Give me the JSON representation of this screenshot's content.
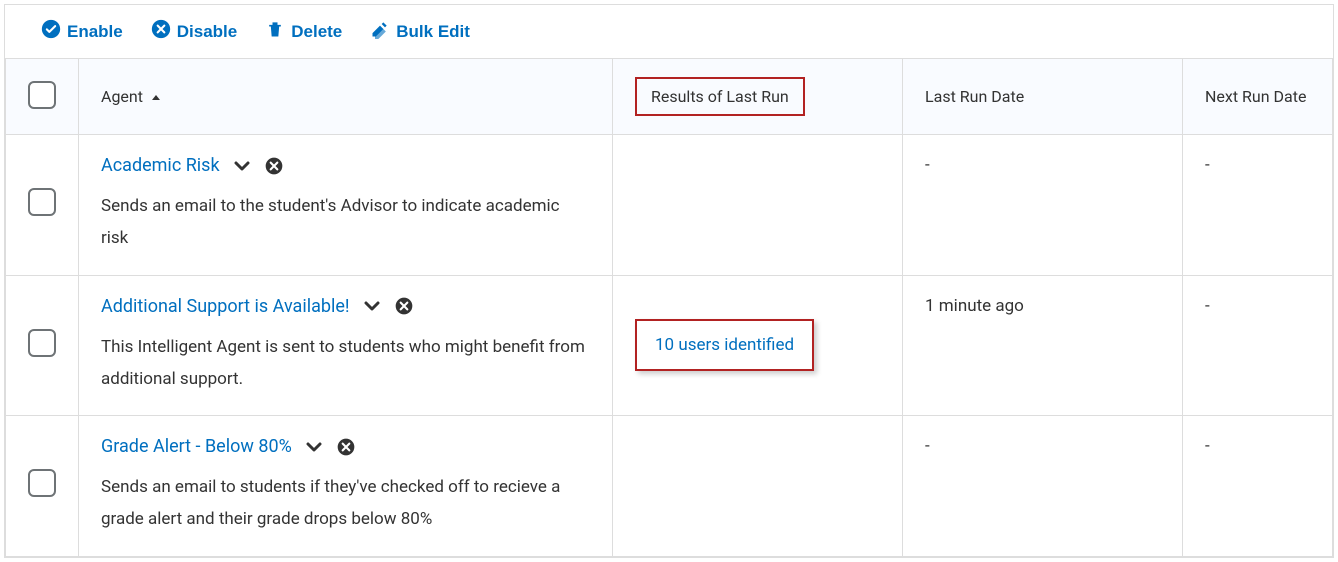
{
  "toolbar": {
    "enable": "Enable",
    "disable": "Disable",
    "delete": "Delete",
    "bulkedit": "Bulk Edit"
  },
  "headers": {
    "agent": "Agent",
    "results": "Results of Last Run",
    "lastrun": "Last Run Date",
    "nextrun": "Next Run Date"
  },
  "rows": [
    {
      "title": "Academic Risk",
      "desc": "Sends an email to the student's Advisor to indicate academic risk",
      "results": "",
      "lastrun": "-",
      "nextrun": "-"
    },
    {
      "title": "Additional Support is Available!",
      "desc": "This Intelligent Agent is sent to students who might benefit from additional support.",
      "results": "10 users identified",
      "lastrun": "1 minute ago",
      "nextrun": "-"
    },
    {
      "title": "Grade Alert - Below 80%",
      "desc": "Sends an email to students if they've checked off to recieve a grade alert and their grade drops below 80%",
      "results": "",
      "lastrun": "-",
      "nextrun": "-"
    }
  ]
}
